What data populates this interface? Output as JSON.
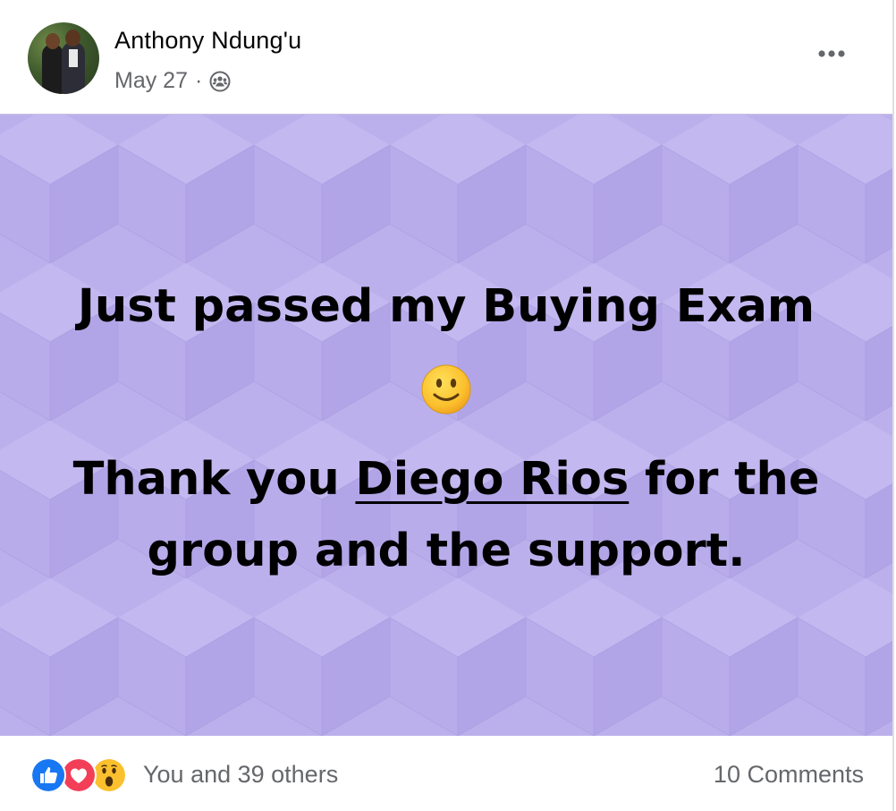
{
  "post": {
    "author": "Anthony Ndung'u",
    "date": "May 27",
    "separator": "·",
    "audience_icon": "group-icon",
    "more_icon": "more-horizontal-icon"
  },
  "content": {
    "line1": "Just passed my Buying Exam",
    "emoji": "slightly-smiling-face-emoji",
    "line2_prefix": "Thank you ",
    "mention": "Diego Rios",
    "line2_suffix": " for the",
    "line3": "group and the support.",
    "background_color": "#bcb0ec"
  },
  "footer": {
    "reaction_icons": [
      "like-icon",
      "love-icon",
      "wow-icon"
    ],
    "reactors": "You and 39 others",
    "comments": "10 Comments"
  }
}
